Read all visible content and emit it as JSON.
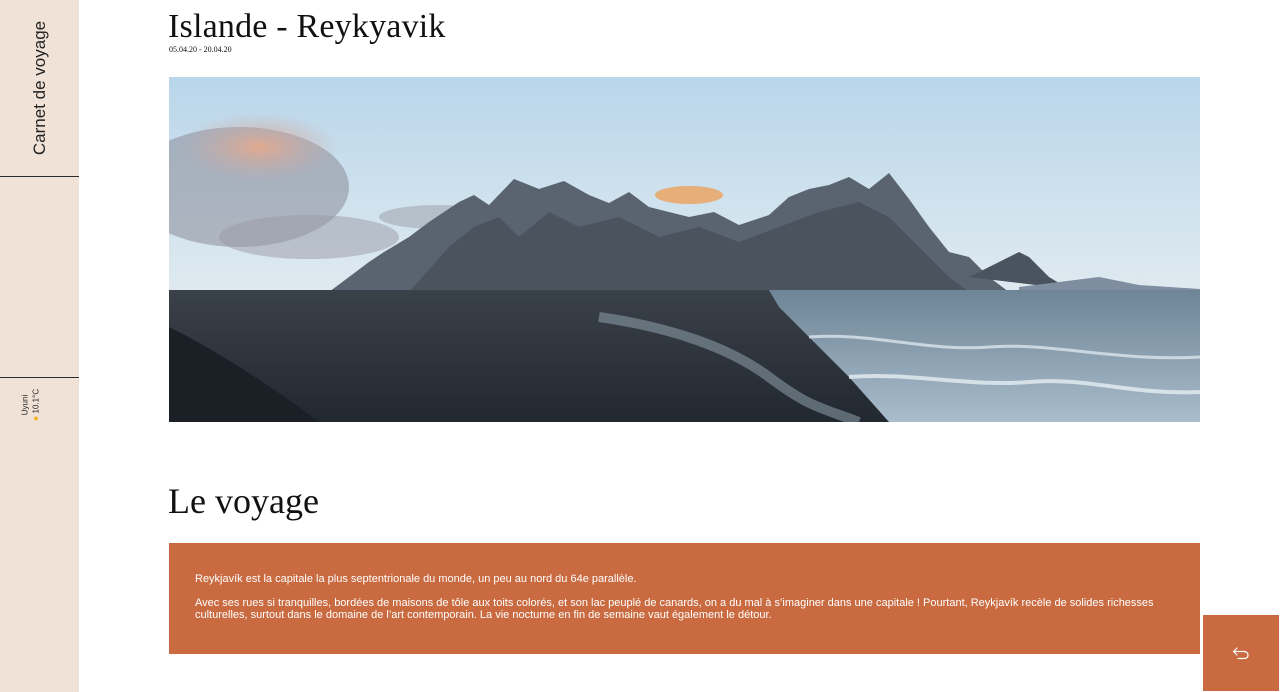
{
  "sidebar": {
    "title": "Carnet de voyage",
    "weather": {
      "city": "Uyuni",
      "temperature": "10.1°C",
      "icon": "sun-icon"
    }
  },
  "header": {
    "title": "Islande - Reykyavik",
    "dates": "05.04.20 - 20.04.20"
  },
  "hero": {
    "icon": "landscape-photo"
  },
  "section": {
    "title": "Le voyage",
    "paragraphs": [
      "Reykjavík est la capitale la plus septentrionale du monde, un peu au nord du 64e parallèle.",
      "Avec ses rues si tranquilles, bordées de maisons de tôle aux toits colorés, et son lac peuplé de canards, on a du mal à s’imaginer dans une capitale ! Pourtant, Reykjavík recèle de solides richesses culturelles, surtout dans le domaine de l’art contemporain. La vie nocturne en fin de semaine vaut également le détour."
    ]
  },
  "back_button": {
    "icon": "back-arrow-icon"
  },
  "colors": {
    "sidebar": "#f0e2d7",
    "accent": "#c96a40"
  }
}
